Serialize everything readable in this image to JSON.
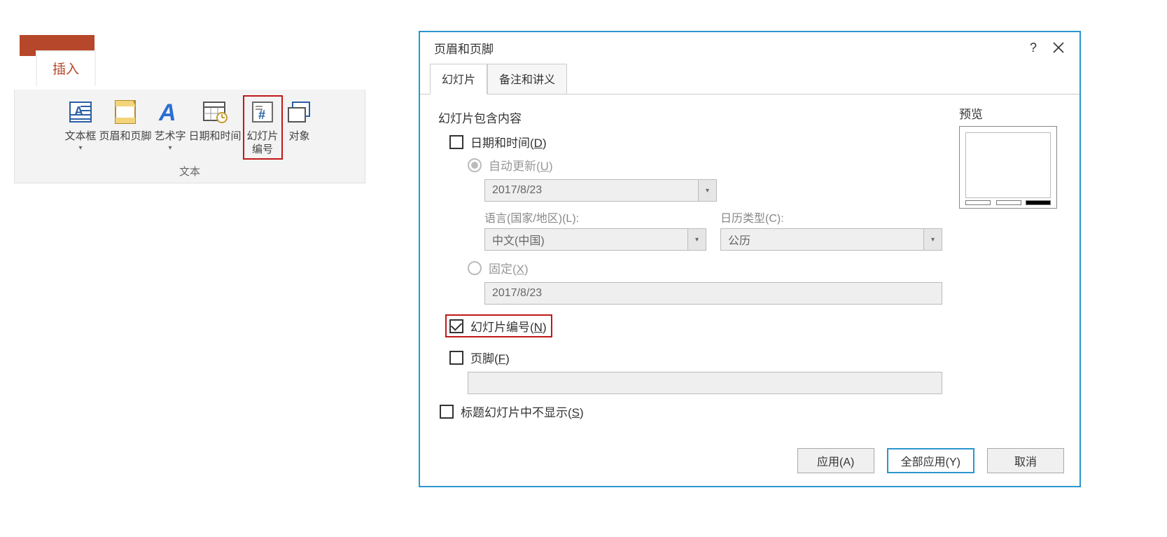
{
  "ribbon": {
    "tab_active": "插入",
    "group_label": "文本",
    "items": {
      "textbox": {
        "line1": "文本框"
      },
      "headerfooter": {
        "line1": "页眉和页脚"
      },
      "wordart": {
        "line1": "艺术字"
      },
      "datetime": {
        "line1": "日期和时间"
      },
      "slidenumber": {
        "line1": "幻灯片",
        "line2": "编号"
      },
      "object": {
        "line1": "对象"
      }
    }
  },
  "dialog": {
    "title": "页眉和页脚",
    "help": "?",
    "tabs": {
      "slide": "幻灯片",
      "notes": "备注和讲义"
    },
    "section_heading": "幻灯片包含内容",
    "datetime": {
      "label_pre": "日期和时间(",
      "label_u": "D",
      "label_post": ")",
      "auto_update_pre": "自动更新(",
      "auto_update_u": "U",
      "auto_update_post": ")",
      "date_value": "2017/8/23",
      "lang_label": "语言(国家/地区)(L):",
      "lang_value": "中文(中国)",
      "calendar_label": "日历类型(C):",
      "calendar_value": "公历",
      "fixed_pre": "固定(",
      "fixed_u": "X",
      "fixed_post": ")",
      "fixed_value": "2017/8/23"
    },
    "slide_number": {
      "label_pre": "幻灯片编号(",
      "label_u": "N",
      "label_post": ")",
      "checked": true
    },
    "footer": {
      "label_pre": "页脚(",
      "label_u": "F",
      "label_post": ")",
      "value": ""
    },
    "hide_title": {
      "label_pre": "标题幻灯片中不显示(",
      "label_u": "S",
      "label_post": ")"
    },
    "preview_label": "预览",
    "buttons": {
      "apply": "应用(A)",
      "apply_all": "全部应用(Y)",
      "cancel": "取消"
    }
  }
}
